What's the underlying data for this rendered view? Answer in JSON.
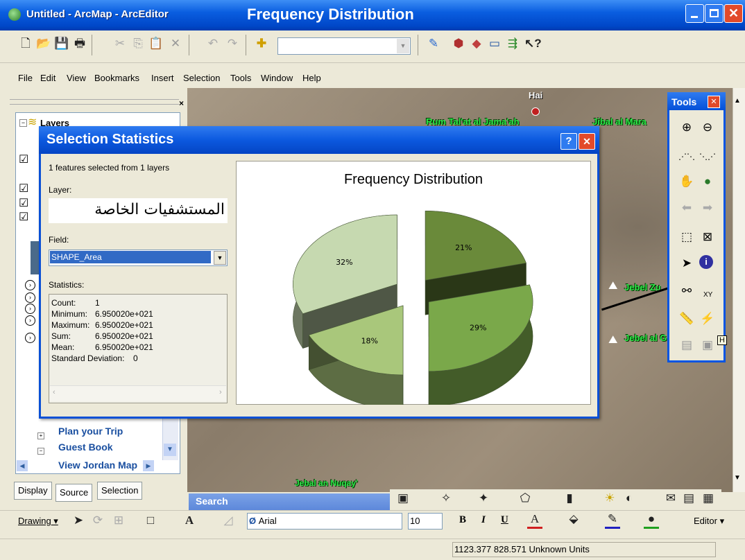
{
  "window": {
    "app_title": "Untitled - ArcMap - ArcEditor",
    "overlay_title": "Frequency Distribution"
  },
  "menu": [
    "File",
    "Edit",
    "View",
    "Bookmarks",
    "Insert",
    "Selection",
    "Tools",
    "Window",
    "Help"
  ],
  "toc": {
    "header": "Layers",
    "links": [
      "Plan your Trip",
      "Guest Book",
      "View Jordan Map"
    ],
    "tabs": [
      "Display",
      "Source",
      "Selection"
    ]
  },
  "map": {
    "labels": {
      "hai": "Hai",
      "rum": "Rum Tal'at al Jama'ah",
      "jibal": "Jibal al Mara",
      "jebel1": "Jebel Zu",
      "jebel2": "Jebel al G",
      "nuqay": "Jebal an Nuqay'"
    },
    "colors": {
      "label": "#2ee84a"
    }
  },
  "tools_palette": {
    "title": "Tools",
    "xy_label": "XY",
    "tooltip": "H"
  },
  "dialog": {
    "title": "Selection Statistics",
    "selected_text": "1 features selected from 1 layers",
    "layer_label": "Layer:",
    "layer_value": "المستشفيات الخاصة",
    "field_label": "Field:",
    "field_value": "SHAPE_Area",
    "statistics_label": "Statistics:",
    "stats": [
      {
        "name": "Count:",
        "value": "1"
      },
      {
        "name": "Minimum:",
        "value": "6.950020e+021"
      },
      {
        "name": "Maximum:",
        "value": "6.950020e+021"
      },
      {
        "name": "Sum:",
        "value": "6.950020e+021"
      },
      {
        "name": "Mean:",
        "value": "6.950020e+021"
      },
      {
        "name": "Standard Deviation:",
        "value": "0"
      }
    ]
  },
  "chart_data": {
    "type": "pie",
    "title": "Frequency Distribution",
    "labels": [
      "21%",
      "29%",
      "18%",
      "32%"
    ],
    "values": [
      21,
      29,
      18,
      32
    ],
    "colors": [
      "#6a8a3a",
      "#7aa84a",
      "#a9c77b",
      "#c6d9b0"
    ]
  },
  "bottom": {
    "search_label": "Search",
    "drawing_label": "Drawing",
    "font_name": "Arial",
    "font_size": "10",
    "bold": "B",
    "italic": "I",
    "underline": "U",
    "editor_label": "Editor",
    "coords": "1123.377  828.571 Unknown Units"
  }
}
